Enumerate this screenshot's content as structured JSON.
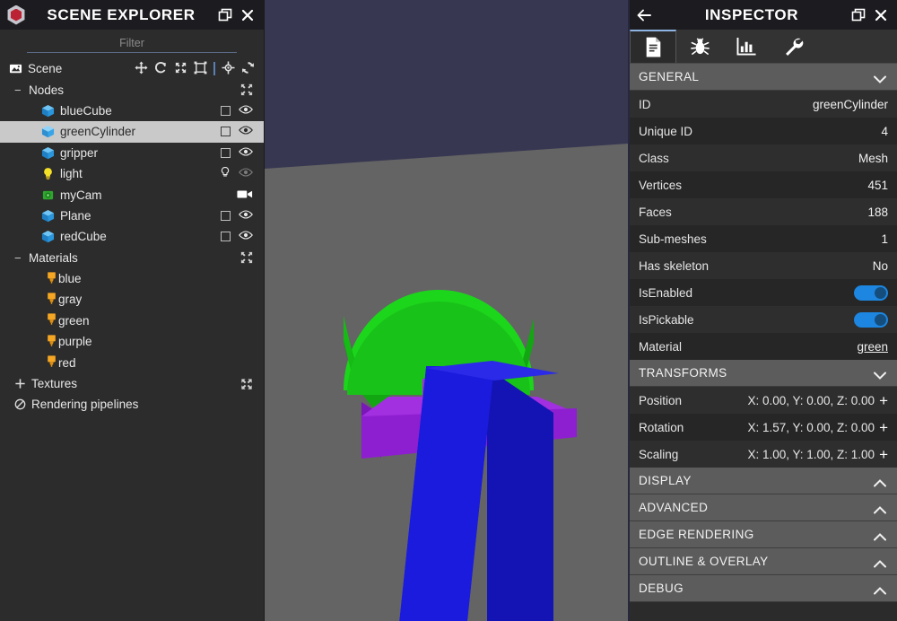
{
  "explorer": {
    "title": "SCENE EXPLORER",
    "logo_icon": "babylon-logo-icon",
    "popout_icon": "popout-window-icon",
    "close_icon": "close-icon",
    "filter": {
      "placeholder": "Filter",
      "value": ""
    },
    "scene_row": {
      "label": "Scene",
      "icon": "scene-image-icon"
    },
    "scene_tools": [
      {
        "name": "translate-gizmo-icon",
        "glyph": "move"
      },
      {
        "name": "rotate-gizmo-icon",
        "glyph": "rotate"
      },
      {
        "name": "scale-gizmo-icon",
        "glyph": "scale"
      },
      {
        "name": "bounding-box-gizmo-icon",
        "glyph": "bbox"
      },
      {
        "name": "pick-target-icon",
        "glyph": "target"
      },
      {
        "name": "refresh-icon",
        "glyph": "refresh"
      }
    ],
    "groups": [
      {
        "label": "Nodes",
        "expander": "−",
        "collapse_icon": "collapse-all-icon",
        "items": [
          {
            "label": "blueCube",
            "icon": "mesh-cube-icon",
            "checkbox": true,
            "eye": "visible"
          },
          {
            "label": "greenCylinder",
            "icon": "mesh-cube-icon",
            "checkbox": true,
            "eye": "visible",
            "selected": true
          },
          {
            "label": "gripper",
            "icon": "mesh-cube-icon",
            "checkbox": true,
            "eye": "visible"
          },
          {
            "label": "light",
            "icon": "light-bulb-icon",
            "checkbox": false,
            "eye": "dimmed",
            "extra_icon": "light-bulb-icon"
          },
          {
            "label": "myCam",
            "icon": "camera-icon",
            "checkbox": false,
            "eye": "none",
            "extra_icon": "video-camera-icon"
          },
          {
            "label": "Plane",
            "icon": "mesh-cube-icon",
            "checkbox": true,
            "eye": "visible"
          },
          {
            "label": "redCube",
            "icon": "mesh-cube-icon",
            "checkbox": true,
            "eye": "visible"
          }
        ]
      },
      {
        "label": "Materials",
        "expander": "−",
        "collapse_icon": "collapse-all-icon",
        "items": [
          {
            "label": "blue",
            "icon": "material-icon"
          },
          {
            "label": "gray",
            "icon": "material-icon"
          },
          {
            "label": "green",
            "icon": "material-icon"
          },
          {
            "label": "purple",
            "icon": "material-icon"
          },
          {
            "label": "red",
            "icon": "material-icon"
          }
        ]
      }
    ],
    "roots": [
      {
        "label": "Textures",
        "expander": "+",
        "icon": "plus-icon",
        "tail_icon": "expand-all-icon"
      },
      {
        "label": "Rendering pipelines",
        "icon": "no-entry-icon"
      }
    ]
  },
  "viewport": {
    "name": "babylon-3d-canvas",
    "sky_color": "#373752",
    "ground_color": "#646464",
    "objects": [
      {
        "name": "green-cylinder-mesh",
        "color": "#19c219"
      },
      {
        "name": "purple-gripper-mesh",
        "color": "#a22fe0"
      },
      {
        "name": "blue-cube-mesh",
        "color": "#1b1bdd"
      }
    ]
  },
  "inspector": {
    "title": "INSPECTOR",
    "back_icon": "back-arrow-icon",
    "popout_icon": "popout-window-icon",
    "close_icon": "close-icon",
    "tabs": [
      {
        "name": "tab-properties",
        "icon": "document-icon",
        "active": true
      },
      {
        "name": "tab-debug",
        "icon": "bug-icon",
        "active": false
      },
      {
        "name": "tab-statistics",
        "icon": "bar-chart-icon",
        "active": false
      },
      {
        "name": "tab-tools",
        "icon": "wrench-icon",
        "active": false
      }
    ],
    "sections": [
      {
        "title": "GENERAL",
        "expanded": true,
        "chevron": "chevron-down-icon",
        "rows": [
          {
            "label": "ID",
            "value": "greenCylinder",
            "type": "text"
          },
          {
            "label": "Unique ID",
            "value": "4",
            "type": "text"
          },
          {
            "label": "Class",
            "value": "Mesh",
            "type": "text"
          },
          {
            "label": "Vertices",
            "value": "451",
            "type": "text"
          },
          {
            "label": "Faces",
            "value": "188",
            "type": "text"
          },
          {
            "label": "Sub-meshes",
            "value": "1",
            "type": "text"
          },
          {
            "label": "Has skeleton",
            "value": "No",
            "type": "text"
          },
          {
            "label": "IsEnabled",
            "value": "on",
            "type": "toggle"
          },
          {
            "label": "IsPickable",
            "value": "on",
            "type": "toggle"
          },
          {
            "label": "Material",
            "value": "green",
            "type": "link"
          }
        ]
      },
      {
        "title": "TRANSFORMS",
        "expanded": true,
        "chevron": "chevron-down-icon",
        "rows": [
          {
            "label": "Position",
            "value": "X: 0.00, Y: 0.00, Z: 0.00",
            "type": "vector",
            "plus": "+"
          },
          {
            "label": "Rotation",
            "value": "X: 1.57, Y: 0.00, Z: 0.00",
            "type": "vector",
            "plus": "+"
          },
          {
            "label": "Scaling",
            "value": "X: 1.00, Y: 1.00, Z: 1.00",
            "type": "vector",
            "plus": "+"
          }
        ]
      },
      {
        "title": "DISPLAY",
        "expanded": false,
        "chevron": "chevron-up-icon",
        "rows": []
      },
      {
        "title": "ADVANCED",
        "expanded": false,
        "chevron": "chevron-up-icon",
        "rows": []
      },
      {
        "title": "EDGE RENDERING",
        "expanded": false,
        "chevron": "chevron-up-icon",
        "rows": []
      },
      {
        "title": "OUTLINE & OVERLAY",
        "expanded": false,
        "chevron": "chevron-up-icon",
        "rows": []
      },
      {
        "title": "DEBUG",
        "expanded": false,
        "chevron": "chevron-up-icon",
        "rows": []
      }
    ]
  },
  "colors": {
    "accent_blue": "#1c86e0",
    "panel_dark": "#1c1c20",
    "section_header": "#5c5c5c",
    "selection": "#c9c9c9"
  }
}
